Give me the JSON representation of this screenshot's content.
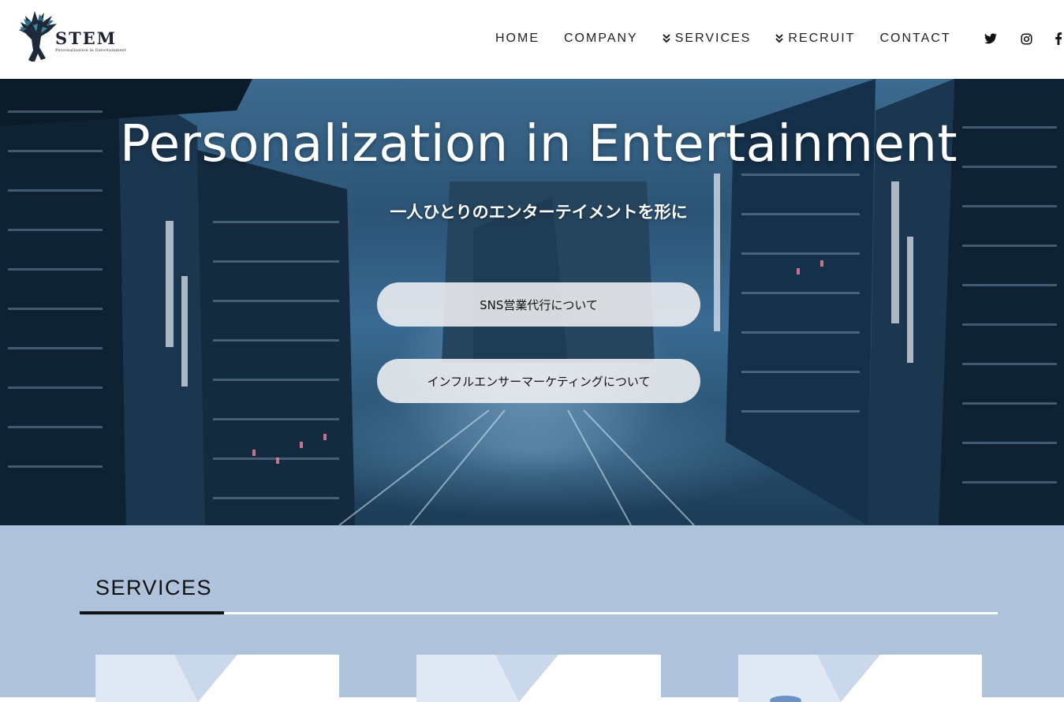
{
  "header": {
    "logo": {
      "name": "STEM",
      "tagline": "Personalization in Entertainment"
    },
    "nav": [
      {
        "label": "HOME",
        "has_dropdown": false
      },
      {
        "label": "COMPANY",
        "has_dropdown": false
      },
      {
        "label": "SERVICES",
        "has_dropdown": true
      },
      {
        "label": "RECRUIT",
        "has_dropdown": true
      },
      {
        "label": "CONTACT",
        "has_dropdown": false
      }
    ],
    "social": [
      "twitter-icon",
      "instagram-icon",
      "facebook-icon"
    ]
  },
  "hero": {
    "title": "Personalization in Entertainment",
    "subtitle": "一人ひとりのエンターテイメントを形に",
    "buttons": [
      {
        "label": "SNS営業代行について"
      },
      {
        "label": "インフルエンサーマーケティングについて"
      }
    ]
  },
  "services": {
    "title": "SERVICES"
  },
  "colors": {
    "services_bg": "#afc2dc",
    "header_bg": "#ffffff",
    "button_bg": "#f0f0f2"
  }
}
